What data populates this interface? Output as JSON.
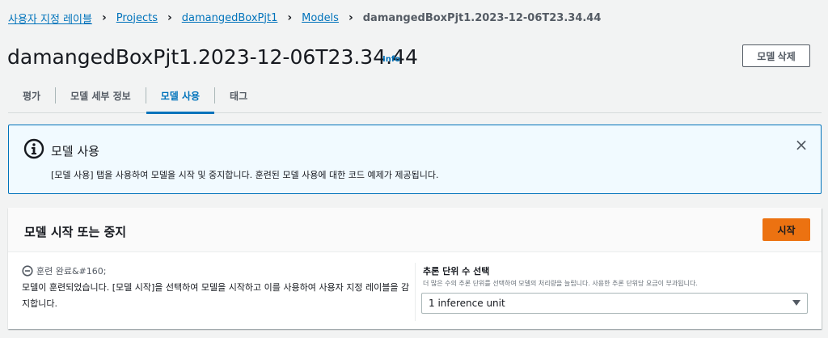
{
  "breadcrumb": {
    "items": [
      "사용자 지정 레이블",
      "Projects",
      "damangedBoxPjt1",
      "Models"
    ],
    "current": "damangedBoxPjt1.2023-12-06T23.34.44",
    "separator": "›"
  },
  "header": {
    "title": "damangedBoxPjt1.2023-12-06T23.34.44",
    "info_label": "Info",
    "delete_label": "모델 삭제"
  },
  "tabs": [
    {
      "label": "평가"
    },
    {
      "label": "모델 세부 정보"
    },
    {
      "label": "모델 사용",
      "active": true
    },
    {
      "label": "태그"
    }
  ],
  "alert": {
    "title": "모델 사용",
    "body": "[모델 사용] 탭을 사용하여 모델을 시작 및 중지합니다. 훈련된 모델 사용에 대한 코드 예제가 제공됩니다.",
    "close": "×",
    "icon": "info-icon"
  },
  "panel": {
    "title": "모델 시작 또는 중지",
    "start_label": "시작",
    "status": "훈련 완료&#160;",
    "status_icon": "minus-circle-icon",
    "description": "모델이 훈련되었습니다. [모델 시작]을 선택하여 모델을 시작하고 이를 사용하여 사용자 지정 레이블을 감지합니다.",
    "field_label": "추론 단위 수 선택",
    "field_description": "더 많은 수의 추론 단위를 선택하여 모델의 처리량을 늘립니다. 사용한 추론 단위당 요금이 부과됩니다.",
    "select_value": "1 inference unit"
  },
  "colors": {
    "link": "#0073bb",
    "primary_button": "#ec7211",
    "alert_bg": "#f1faff",
    "page_bg": "#f2f3f3"
  }
}
